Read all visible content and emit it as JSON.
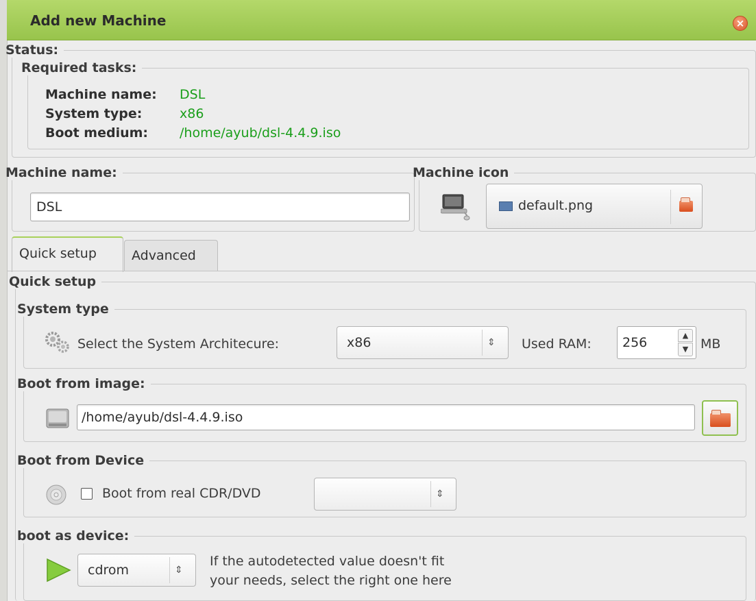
{
  "window": {
    "title": "Add new Machine",
    "close_symbol": "×"
  },
  "status": {
    "legend": "Status:",
    "required": {
      "legend": "Required tasks:",
      "machine_name_label": "Machine name:",
      "machine_name_value": "DSL",
      "system_type_label": "System type:",
      "system_type_value": "x86",
      "boot_medium_label": "Boot medium:",
      "boot_medium_value": "/home/ayub/dsl-4.4.9.iso"
    }
  },
  "machine_name": {
    "legend": "Machine name:",
    "value": "DSL"
  },
  "machine_icon": {
    "legend": "Machine icon",
    "file": "default.png",
    "icon": "computer-icon"
  },
  "tabs": [
    {
      "label": "Quick setup",
      "active": true
    },
    {
      "label": "Advanced",
      "active": false
    }
  ],
  "quick_setup": {
    "legend": "Quick setup",
    "system_type": {
      "legend": "System type",
      "arch_label": "Select the System Architecure:",
      "arch_value": "x86",
      "ram_label": "Used RAM:",
      "ram_value": "256",
      "ram_unit": "MB"
    },
    "boot_image": {
      "legend": "Boot from image:",
      "path": "/home/ayub/dsl-4.4.9.iso"
    },
    "boot_device": {
      "legend": "Boot from Device",
      "checkbox_label": "Boot from real CDR/DVD",
      "checked": false,
      "device_value": ""
    },
    "boot_as": {
      "legend": "boot as device:",
      "value": "cdrom",
      "hint_line1": "If the autodetected value doesn't fit",
      "hint_line2": "your needs, select the right one here"
    }
  },
  "colors": {
    "titlebar": "#a8d15a",
    "status_value": "#1a9e1a",
    "play_icon": "#7cc53a",
    "file_icon": "#e0622f"
  }
}
